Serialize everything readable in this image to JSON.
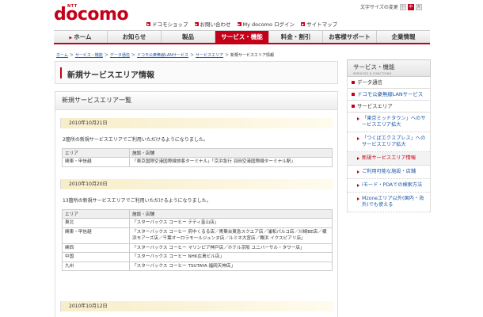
{
  "header": {
    "logo_brand": "NTT",
    "logo_text": "docomo",
    "text_size_label": "文字サイズの変更",
    "text_size_buttons": [
      "小",
      "中",
      "大"
    ],
    "utility_links": [
      "ドコモショップ",
      "お問い合わせ",
      "My docomo ログイン",
      "サイトマップ"
    ]
  },
  "gnav": {
    "items": [
      "ホーム",
      "お知らせ",
      "製品",
      "サービス・機能",
      "料金・割引",
      "お客様サポート",
      "企業情報"
    ],
    "active_index": 3
  },
  "breadcrumb": {
    "links": [
      "ホーム",
      "サービス・機能",
      "データ通信",
      "ドコモ公衆無線LANサービス",
      "サービスエリア"
    ],
    "current": "新規サービスエリア情報",
    "separator": "＞"
  },
  "page_title": "新規サービスエリア情報",
  "section": {
    "title": "新規サービスエリア一覧",
    "table_headers": [
      "エリア",
      "施設・店舗"
    ],
    "groups": [
      {
        "date": "2010年10月21日",
        "intro": "2箇所の新規サービスエリアでご利用いただけるようになりました。",
        "rows": [
          {
            "area": "関東・甲信越",
            "facility": "「東京国際空港国際線旅客ターミナル」「京浜急行 羽田空港国際線ターミナル駅」"
          }
        ]
      },
      {
        "date": "2010年10月20日",
        "intro": "13箇所の新規サービスエリアでご利用いただけるようになりました。",
        "rows": [
          {
            "area": "東北",
            "facility": "「スターバックス コーヒー テティ韮山店」"
          },
          {
            "area": "関東・甲信越",
            "facility": "「スターバックス コーヒー 府中くるる店／青葉台東急スクエア店／浦和パルコ店／川崎BE店／横浜モアーズ店／千葉オーロラモールジュンヌ店／ルミネ大宮店／舞浜 イクスピアリ店」"
          },
          {
            "area": "関西",
            "facility": "「スターバックス コーヒー マリンピア神戸店／ホテル京阪 ユニバーサル・タワー店」"
          },
          {
            "area": "中国",
            "facility": "「スターバックス コーヒー NHK広島ビル店」"
          },
          {
            "area": "九州",
            "facility": "「スターバックス コーヒー TSUTAYA 福岡天神店」"
          }
        ]
      },
      {
        "date": "2010年10月12日"
      }
    ]
  },
  "sidebar": {
    "title": "サービス・機能",
    "subtitle": "SERVICES & FUNCTIONS",
    "categories": [
      "データ通信",
      "ドコモ公衆無線LANサービス",
      "サービスエリア"
    ],
    "items": [
      "「東京ミッドタウン」へのサービスエリア拡大",
      "「つくばエクスプレス」へのサービスエリア拡大",
      "新規サービスエリア情報",
      "ご利用可能な施設・店舗",
      "iモード・PDAでの検索方法",
      "Mzoneエリア以外(国内・海外)でも使える"
    ],
    "active_item_index": 2
  },
  "colors": {
    "brand_red": "#c40018",
    "link_blue": "#1a57a6",
    "date_bar": "#f7edc8"
  }
}
